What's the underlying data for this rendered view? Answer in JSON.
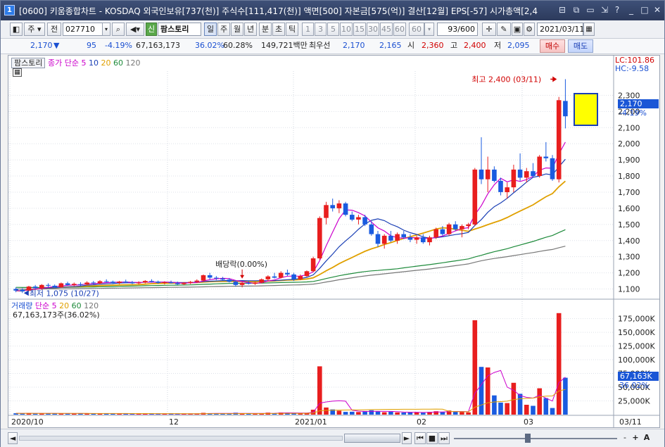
{
  "window": {
    "number": "1",
    "title": "[0600] 키움종합차트 - KOSDAQ 외국인보유[737(천)] 주식수[111,417(천)] 액면[500] 자본금[575(억)] 결산[12월] EPS[-57] 시가총액[2,4",
    "controls": [
      "⊟",
      "⧉",
      "▭",
      "⇲",
      "?",
      "_",
      "□",
      "✕"
    ]
  },
  "toolbar": {
    "period": "주",
    "prev": "전",
    "code": "027710",
    "new_label": "신",
    "name": "팜스토리",
    "tabs": [
      "일",
      "주",
      "월",
      "년",
      "분",
      "초",
      "틱"
    ],
    "intervals": [
      "1",
      "3",
      "5",
      "10",
      "15",
      "30",
      "45",
      "60",
      "60"
    ],
    "count": "93/600",
    "date": "2021/03/11"
  },
  "quote": {
    "price": "2,170",
    "arrow": "▼",
    "change": "95",
    "change_pct": "-4.19%",
    "volume": "67,163,173",
    "vol_ratio": "36.02%",
    "turnover": "60.28%",
    "amount": "149,721백만",
    "pref_label": "최우선",
    "ask": "2,170",
    "bid": "2,165",
    "open_label": "시",
    "open": "2,360",
    "high_label": "고",
    "high": "2,400",
    "low_label": "저",
    "low": "2,095",
    "buy_label": "매수",
    "sell_label": "매도"
  },
  "price_pane": {
    "legend_name": "팜스토리",
    "legend_type": "종가 단순",
    "ma_labels": [
      "5",
      "10",
      "20",
      "60",
      "120"
    ],
    "ma_colors": [
      "#cc00cc",
      "#1a3fb5",
      "#e0a000",
      "#1d8a3a",
      "#777777"
    ],
    "lc_label": "LC:101.86",
    "hc_label": "HC:-9.58",
    "current_price": "2,170",
    "current_pct": "-4.19%",
    "high_annotation": "최고 2,400 (03/11)",
    "low_annotation": "최저 1,075 (10/27)",
    "dividend_annotation": "배당락(0.00%)"
  },
  "volume_pane": {
    "legend_name": "거래량",
    "legend_type": "단순",
    "ma_labels": [
      "5",
      "20",
      "60",
      "120"
    ],
    "current_text": "67,163,173주(36.02%)",
    "current_label": "67,163K",
    "current_pct": "36.02%"
  },
  "xaxis": {
    "labels": [
      "2020/10",
      "12",
      "2021/01",
      "02",
      "03"
    ],
    "right_label": "03/11"
  },
  "bottom": {
    "buttons": [
      "◄",
      "►",
      "⏮",
      "■",
      "⏭",
      "-",
      "+",
      "A"
    ]
  },
  "chart_data": [
    {
      "type": "candlestick",
      "title": "",
      "ylim": [
        1050,
        2450
      ],
      "y_ticks": [
        1100,
        1200,
        1300,
        1400,
        1500,
        1600,
        1700,
        1800,
        1900,
        2000,
        2100,
        2200,
        2300
      ],
      "x_tick_labels": [
        "2020/10",
        "12",
        "2021/01",
        "02",
        "03"
      ],
      "candles": [
        {
          "o": 1100,
          "h": 1110,
          "l": 1080,
          "c": 1090
        },
        {
          "o": 1095,
          "h": 1105,
          "l": 1075,
          "c": 1085
        },
        {
          "o": 1090,
          "h": 1120,
          "l": 1085,
          "c": 1115
        },
        {
          "o": 1115,
          "h": 1125,
          "l": 1100,
          "c": 1105
        },
        {
          "o": 1105,
          "h": 1130,
          "l": 1095,
          "c": 1125
        },
        {
          "o": 1125,
          "h": 1135,
          "l": 1110,
          "c": 1120
        },
        {
          "o": 1120,
          "h": 1128,
          "l": 1105,
          "c": 1110
        },
        {
          "o": 1110,
          "h": 1140,
          "l": 1108,
          "c": 1135
        },
        {
          "o": 1135,
          "h": 1145,
          "l": 1120,
          "c": 1125
        },
        {
          "o": 1125,
          "h": 1140,
          "l": 1118,
          "c": 1132
        },
        {
          "o": 1130,
          "h": 1142,
          "l": 1120,
          "c": 1128
        },
        {
          "o": 1128,
          "h": 1148,
          "l": 1122,
          "c": 1140
        },
        {
          "o": 1140,
          "h": 1150,
          "l": 1128,
          "c": 1135
        },
        {
          "o": 1135,
          "h": 1155,
          "l": 1130,
          "c": 1148
        },
        {
          "o": 1148,
          "h": 1160,
          "l": 1140,
          "c": 1145
        },
        {
          "o": 1145,
          "h": 1152,
          "l": 1130,
          "c": 1138
        },
        {
          "o": 1138,
          "h": 1150,
          "l": 1130,
          "c": 1146
        },
        {
          "o": 1146,
          "h": 1158,
          "l": 1138,
          "c": 1142
        },
        {
          "o": 1142,
          "h": 1150,
          "l": 1130,
          "c": 1135
        },
        {
          "o": 1135,
          "h": 1148,
          "l": 1128,
          "c": 1140
        },
        {
          "o": 1140,
          "h": 1155,
          "l": 1135,
          "c": 1150
        },
        {
          "o": 1150,
          "h": 1160,
          "l": 1140,
          "c": 1145
        },
        {
          "o": 1145,
          "h": 1152,
          "l": 1132,
          "c": 1138
        },
        {
          "o": 1138,
          "h": 1148,
          "l": 1128,
          "c": 1142
        },
        {
          "o": 1142,
          "h": 1152,
          "l": 1134,
          "c": 1136
        },
        {
          "o": 1136,
          "h": 1146,
          "l": 1126,
          "c": 1130
        },
        {
          "o": 1130,
          "h": 1142,
          "l": 1124,
          "c": 1138
        },
        {
          "o": 1138,
          "h": 1150,
          "l": 1130,
          "c": 1144
        },
        {
          "o": 1144,
          "h": 1160,
          "l": 1138,
          "c": 1152
        },
        {
          "o": 1152,
          "h": 1190,
          "l": 1145,
          "c": 1185
        },
        {
          "o": 1185,
          "h": 1200,
          "l": 1160,
          "c": 1170
        },
        {
          "o": 1170,
          "h": 1180,
          "l": 1155,
          "c": 1165
        },
        {
          "o": 1165,
          "h": 1175,
          "l": 1150,
          "c": 1158
        },
        {
          "o": 1158,
          "h": 1168,
          "l": 1140,
          "c": 1145
        },
        {
          "o": 1145,
          "h": 1155,
          "l": 1115,
          "c": 1125
        },
        {
          "o": 1125,
          "h": 1145,
          "l": 1110,
          "c": 1138
        },
        {
          "o": 1138,
          "h": 1150,
          "l": 1128,
          "c": 1132
        },
        {
          "o": 1132,
          "h": 1145,
          "l": 1125,
          "c": 1140
        },
        {
          "o": 1140,
          "h": 1165,
          "l": 1135,
          "c": 1160
        },
        {
          "o": 1160,
          "h": 1185,
          "l": 1150,
          "c": 1178
        },
        {
          "o": 1178,
          "h": 1200,
          "l": 1165,
          "c": 1170
        },
        {
          "o": 1170,
          "h": 1210,
          "l": 1165,
          "c": 1200
        },
        {
          "o": 1200,
          "h": 1220,
          "l": 1180,
          "c": 1190
        },
        {
          "o": 1190,
          "h": 1200,
          "l": 1150,
          "c": 1160
        },
        {
          "o": 1160,
          "h": 1190,
          "l": 1155,
          "c": 1180
        },
        {
          "o": 1180,
          "h": 1215,
          "l": 1175,
          "c": 1210
        },
        {
          "o": 1210,
          "h": 1300,
          "l": 1205,
          "c": 1290
        },
        {
          "o": 1290,
          "h": 1550,
          "l": 1280,
          "c": 1540
        },
        {
          "o": 1540,
          "h": 1640,
          "l": 1500,
          "c": 1620
        },
        {
          "o": 1620,
          "h": 1660,
          "l": 1580,
          "c": 1600
        },
        {
          "o": 1600,
          "h": 1650,
          "l": 1570,
          "c": 1630
        },
        {
          "o": 1630,
          "h": 1640,
          "l": 1550,
          "c": 1560
        },
        {
          "o": 1560,
          "h": 1580,
          "l": 1520,
          "c": 1530
        },
        {
          "o": 1530,
          "h": 1560,
          "l": 1500,
          "c": 1545
        },
        {
          "o": 1545,
          "h": 1560,
          "l": 1490,
          "c": 1500
        },
        {
          "o": 1500,
          "h": 1520,
          "l": 1430,
          "c": 1440
        },
        {
          "o": 1440,
          "h": 1460,
          "l": 1360,
          "c": 1380
        },
        {
          "o": 1380,
          "h": 1440,
          "l": 1350,
          "c": 1430
        },
        {
          "o": 1430,
          "h": 1460,
          "l": 1390,
          "c": 1400
        },
        {
          "o": 1400,
          "h": 1450,
          "l": 1380,
          "c": 1440
        },
        {
          "o": 1440,
          "h": 1460,
          "l": 1410,
          "c": 1420
        },
        {
          "o": 1420,
          "h": 1440,
          "l": 1390,
          "c": 1405
        },
        {
          "o": 1405,
          "h": 1430,
          "l": 1380,
          "c": 1420
        },
        {
          "o": 1420,
          "h": 1440,
          "l": 1380,
          "c": 1390
        },
        {
          "o": 1390,
          "h": 1430,
          "l": 1370,
          "c": 1420
        },
        {
          "o": 1420,
          "h": 1480,
          "l": 1410,
          "c": 1470
        },
        {
          "o": 1470,
          "h": 1490,
          "l": 1430,
          "c": 1440
        },
        {
          "o": 1440,
          "h": 1510,
          "l": 1430,
          "c": 1500
        },
        {
          "o": 1500,
          "h": 1520,
          "l": 1460,
          "c": 1470
        },
        {
          "o": 1470,
          "h": 1500,
          "l": 1420,
          "c": 1490
        },
        {
          "o": 1490,
          "h": 1510,
          "l": 1470,
          "c": 1500
        },
        {
          "o": 1500,
          "h": 1850,
          "l": 1490,
          "c": 1840
        },
        {
          "o": 1840,
          "h": 2040,
          "l": 1750,
          "c": 1780
        },
        {
          "o": 1780,
          "h": 1920,
          "l": 1700,
          "c": 1840
        },
        {
          "o": 1840,
          "h": 1860,
          "l": 1760,
          "c": 1770
        },
        {
          "o": 1770,
          "h": 1790,
          "l": 1680,
          "c": 1700
        },
        {
          "o": 1700,
          "h": 1760,
          "l": 1660,
          "c": 1730
        },
        {
          "o": 1730,
          "h": 1870,
          "l": 1700,
          "c": 1840
        },
        {
          "o": 1840,
          "h": 1940,
          "l": 1770,
          "c": 1790
        },
        {
          "o": 1790,
          "h": 1850,
          "l": 1760,
          "c": 1830
        },
        {
          "o": 1830,
          "h": 1880,
          "l": 1790,
          "c": 1800
        },
        {
          "o": 1800,
          "h": 1930,
          "l": 1790,
          "c": 1920
        },
        {
          "o": 1920,
          "h": 2010,
          "l": 1890,
          "c": 1910
        },
        {
          "o": 1910,
          "h": 1930,
          "l": 1770,
          "c": 1780
        },
        {
          "o": 1780,
          "h": 2290,
          "l": 1760,
          "c": 2270
        },
        {
          "o": 2265,
          "h": 2400,
          "l": 2095,
          "c": 2170
        }
      ],
      "moving_averages": [
        {
          "label": "5",
          "color": "#cc00cc"
        },
        {
          "label": "10",
          "color": "#1a3fb5"
        },
        {
          "label": "20",
          "color": "#e0a000"
        },
        {
          "label": "60",
          "color": "#1d8a3a"
        },
        {
          "label": "120",
          "color": "#777777"
        }
      ],
      "annotations": [
        {
          "text": "최고 2,400 (03/11)",
          "index": 84,
          "value": 2400
        },
        {
          "text": "최저 1,075 (10/27)",
          "index": 1,
          "value": 1075
        },
        {
          "text": "배당락(0.00%)",
          "index": 35,
          "value": 1160
        }
      ]
    },
    {
      "type": "bar",
      "title": "",
      "ylabel": "거래량",
      "ylim": [
        0,
        195000
      ],
      "y_ticks": [
        25000,
        50000,
        75000,
        100000,
        125000,
        150000,
        175000
      ],
      "y_tick_labels": [
        "25,000K",
        "50,000K",
        "75,000K",
        "100,000K",
        "125,000K",
        "150,000K",
        "175,000K"
      ],
      "x_tick_labels": [
        "2020/10",
        "12",
        "2021/01",
        "02",
        "03"
      ],
      "values": [
        2500,
        2100,
        2800,
        1800,
        2200,
        1900,
        2000,
        2600,
        1700,
        1800,
        1900,
        2300,
        1700,
        2100,
        1800,
        1500,
        1600,
        1900,
        1400,
        1600,
        2100,
        1500,
        1300,
        1400,
        1600,
        1500,
        1400,
        1500,
        1700,
        3200,
        2400,
        1900,
        1800,
        2100,
        3400,
        2000,
        1600,
        1800,
        2600,
        3600,
        2600,
        3900,
        3100,
        2400,
        2200,
        3100,
        9000,
        88000,
        13000,
        9500,
        7200,
        5000,
        5300,
        4800,
        6500,
        8000,
        5600,
        4400,
        5200,
        4000,
        3700,
        4600,
        4400,
        3500,
        4900,
        6200,
        4800,
        7500,
        5500,
        4900,
        4100,
        172000,
        87000,
        86000,
        35000,
        22000,
        21000,
        58000,
        38000,
        18000,
        16000,
        48000,
        30000,
        12000,
        185000,
        67163
      ],
      "current_label": "67,163K"
    }
  ]
}
